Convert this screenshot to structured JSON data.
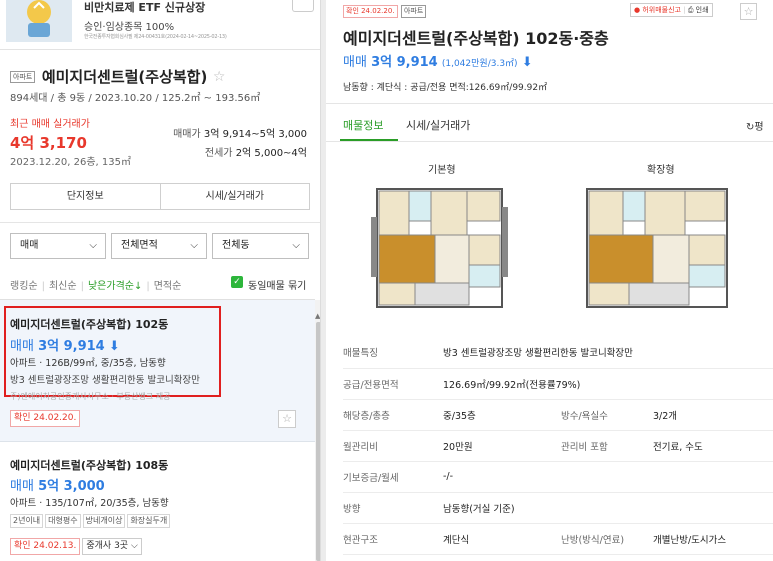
{
  "banner": {
    "title": "비만치료제 ETF 신규상장",
    "subtitle": "승인·임상종목 100%",
    "fine_print": "한국전종투자협회심사필 제24-00431호(2024-02-14~2025-02-13)"
  },
  "complex": {
    "type_tag": "아파트",
    "name": "예미지더센트럴(주상복합)",
    "info": "894세대 / 총 9동 / 2023.10.20 / 125.2㎡ ~ 193.56㎡",
    "recent_label": "최근 매매 실거래가",
    "recent_price": "4억 3,170",
    "recent_date": "2023.12.20, 26층, 135㎡",
    "sale_range_label": "매매가",
    "sale_range": "3억 9,914~5억 3,000",
    "jeonse_range_label": "전세가",
    "jeonse_range": "2억 5,000~4억",
    "btn_info": "단지정보",
    "btn_price": "시세/실거래가"
  },
  "filters": {
    "trade": "매매",
    "area": "전체면적",
    "dong": "전체동"
  },
  "sort": {
    "ranking": "랭킹순",
    "latest": "최신순",
    "low_price": "낮은가격순↓",
    "area": "면적순",
    "group_label": "동일매물 묶기"
  },
  "listings": [
    {
      "title": "예미지더센트럴(주상복합) 102동",
      "price_type": "매매",
      "price": "3억 9,914",
      "spec": "아파트 · 126B/99㎡, 중/35층, 남동향",
      "desc": "방3 센트럴광장조망 생활편리한동 발코니확장만",
      "agent": "주)엔에이치공인중개사사무소 · 부동산뱅크 제공",
      "confirm": "확인 24.02.20."
    },
    {
      "title": "예미지더센트럴(주상복합) 108동",
      "price_type": "매매",
      "price": "5억 3,000",
      "spec": "아파트 · 135/107㎡, 20/35층, 남동향",
      "tags": [
        "2년이내",
        "대형평수",
        "방네개이상",
        "화장실두개"
      ],
      "confirm": "확인 24.02.13.",
      "agent_count": "중개사 3곳"
    }
  ],
  "detail": {
    "confirm": "확인 24.02.20.",
    "type_tag": "아파트",
    "report": "허위매물신고",
    "print": "인쇄",
    "title": "예미지더센트럴(주상복합) 102동·중층",
    "price_type": "매매",
    "price": "3억 9,914",
    "price_per": "(1,042만원/3.3㎡)",
    "sub": "남동향 : 계단식 : 공급/전용 면적:126.69㎡/99.92㎡",
    "tab_info": "매물정보",
    "tab_price": "시세/실거래가",
    "tab_right": "평",
    "fp_basic": "기본형",
    "fp_ext": "확장형",
    "rows": [
      {
        "k": "매물특징",
        "v": "방3 센트럴광장조망 생활편리한동 발코니확장만"
      },
      {
        "k": "공급/전용면적",
        "v": "126.69㎡/99.92㎡(전용률79%)"
      },
      {
        "k": "해당층/총층",
        "v": "중/35층",
        "k2": "방수/욕실수",
        "v2": "3/2개"
      },
      {
        "k": "월관리비",
        "v": "20만원",
        "k2": "관리비 포함",
        "v2": "전기료, 수도"
      },
      {
        "k": "기보증금/월세",
        "v": "-/-"
      },
      {
        "k": "방향",
        "v": "남동향(거실 기준)"
      },
      {
        "k": "현관구조",
        "v": "계단식",
        "k2": "난방(방식/연료)",
        "v2": "개별난방/도시가스"
      }
    ]
  },
  "colors": {
    "accent": "#2a9d27",
    "price_blue": "#2f7de1",
    "red": "#e8382c"
  }
}
